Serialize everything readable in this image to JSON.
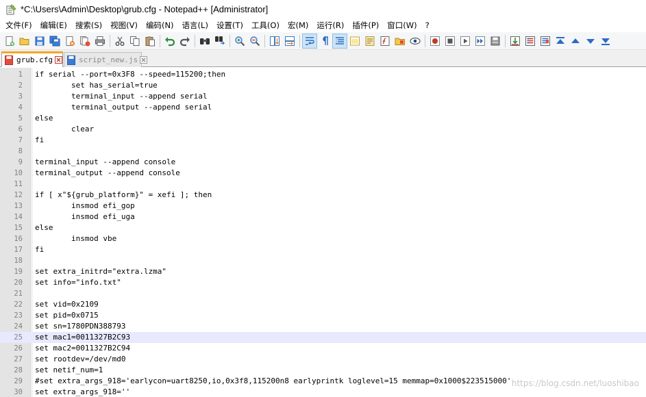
{
  "window": {
    "title": "*C:\\Users\\Admin\\Desktop\\grub.cfg - Notepad++ [Administrator]"
  },
  "menu": [
    "文件(F)",
    "编辑(E)",
    "搜索(S)",
    "视图(V)",
    "编码(N)",
    "语言(L)",
    "设置(T)",
    "工具(O)",
    "宏(M)",
    "运行(R)",
    "插件(P)",
    "窗口(W)",
    "?"
  ],
  "toolbar": {
    "groups": [
      [
        "new-file-icon",
        "open-file-icon",
        "save-icon",
        "save-all-icon",
        "close-icon",
        "close-all-icon",
        "print-icon"
      ],
      [
        "cut-icon",
        "copy-icon",
        "paste-icon"
      ],
      [
        "undo-icon",
        "redo-icon"
      ],
      [
        "find-icon",
        "replace-icon"
      ],
      [
        "zoom-in-icon",
        "zoom-out-icon"
      ],
      [
        "sync-vertical-icon",
        "sync-horizontal-icon"
      ],
      [
        "word-wrap-icon",
        "show-all-chars-icon",
        "indent-guide-icon",
        "define-language-icon",
        "document-map-icon",
        "function-list-icon",
        "folder-as-workspace-icon",
        "monitoring-icon"
      ],
      [
        "record-macro-icon",
        "stop-macro-icon",
        "play-macro-icon",
        "run-macro-multiple-icon",
        "save-macro-icon"
      ],
      [
        "compare-icon",
        "compare-lines-icon",
        "compare-clear-icon",
        "compare-first-icon",
        "compare-prev-icon",
        "compare-next-icon",
        "compare-last-icon"
      ]
    ],
    "active": [
      "word-wrap-icon",
      "indent-guide-icon"
    ]
  },
  "tabs": [
    {
      "label": "grub.cfg",
      "active": true,
      "modified": true
    },
    {
      "label": "script_new.js",
      "active": false,
      "modified": false
    }
  ],
  "editor": {
    "current_line": 25,
    "lines": [
      {
        "n": "1",
        "text": "if serial --port=0x3F8 --speed=115200;then"
      },
      {
        "n": "2",
        "text": "        set has_serial=true"
      },
      {
        "n": "3",
        "text": "        terminal_input --append serial"
      },
      {
        "n": "4",
        "text": "        terminal_output --append serial"
      },
      {
        "n": "5",
        "text": "else"
      },
      {
        "n": "6",
        "text": "        clear"
      },
      {
        "n": "7",
        "text": "fi"
      },
      {
        "n": "8",
        "text": ""
      },
      {
        "n": "9",
        "text": "terminal_input --append console"
      },
      {
        "n": "10",
        "text": "terminal_output --append console"
      },
      {
        "n": "11",
        "text": ""
      },
      {
        "n": "12",
        "text": "if [ x\"${grub_platform}\" = xefi ]; then"
      },
      {
        "n": "13",
        "text": "        insmod efi_gop"
      },
      {
        "n": "14",
        "text": "        insmod efi_uga"
      },
      {
        "n": "15",
        "text": "else"
      },
      {
        "n": "16",
        "text": "        insmod vbe"
      },
      {
        "n": "17",
        "text": "fi"
      },
      {
        "n": "18",
        "text": ""
      },
      {
        "n": "19",
        "text": "set extra_initrd=\"extra.lzma\""
      },
      {
        "n": "20",
        "text": "set info=\"info.txt\""
      },
      {
        "n": "21",
        "text": ""
      },
      {
        "n": "22",
        "text": "set vid=0x2109"
      },
      {
        "n": "23",
        "text": "set pid=0x0715"
      },
      {
        "n": "24",
        "text": "set sn=1780PDN388793"
      },
      {
        "n": "25",
        "text": "set mac1=0011327B2C93"
      },
      {
        "n": "26",
        "text": "set mac2=0011327B2C94"
      },
      {
        "n": "27",
        "text": "set rootdev=/dev/md0"
      },
      {
        "n": "28",
        "text": "set netif_num=1"
      },
      {
        "n": "29",
        "text": "#set extra_args_918='earlycon=uart8250,io,0x3f8,115200n8 earlyprintk loglevel=15 memmap=0x1000$223515000'"
      },
      {
        "n": "30",
        "text": "set extra_args_918=''"
      }
    ]
  },
  "watermark": "https://blog.csdn.net/luoshibao",
  "colors": {
    "accent_tab": "#f5a623",
    "current_line_bg": "#e8e8ff",
    "gutter_bg": "#e4e4e4",
    "line_number": "#808080"
  }
}
